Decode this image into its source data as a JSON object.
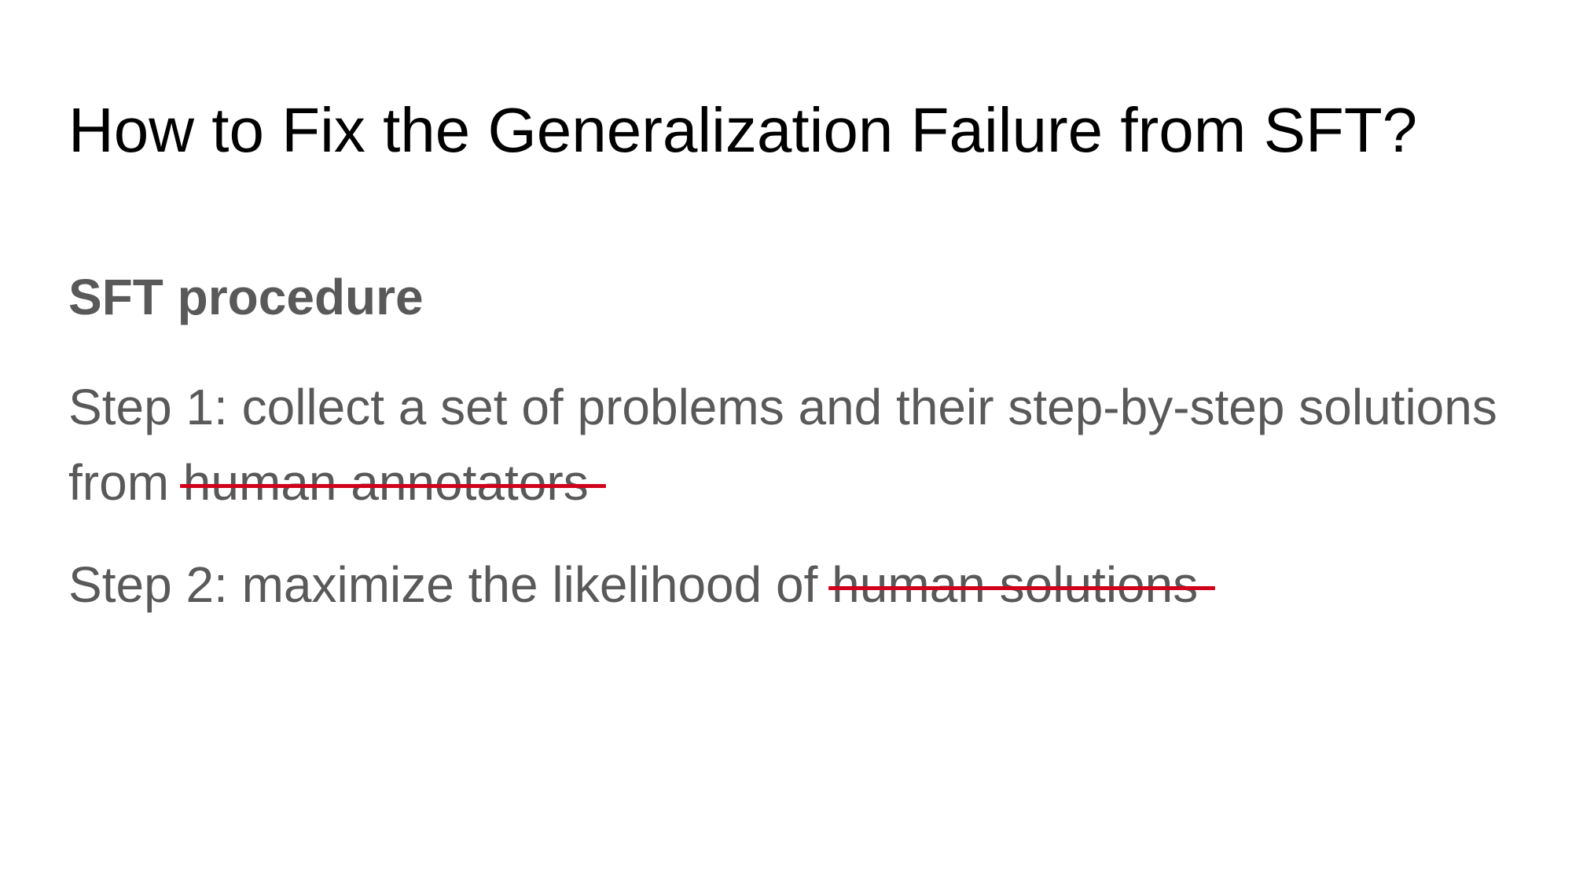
{
  "slide": {
    "title": "How to Fix the Generalization Failure from SFT?",
    "section_heading": "SFT procedure",
    "steps": [
      {
        "text": "Step 1: collect a set of problems and their step-by-step solutions from ",
        "struck_text": "human annotators"
      },
      {
        "text": "Step 2: maximize the likelihood of ",
        "struck_text": "human solutions"
      }
    ],
    "colors": {
      "title": "#000000",
      "body": "#595959",
      "strike": "#d0021b",
      "background": "#ffffff"
    }
  }
}
